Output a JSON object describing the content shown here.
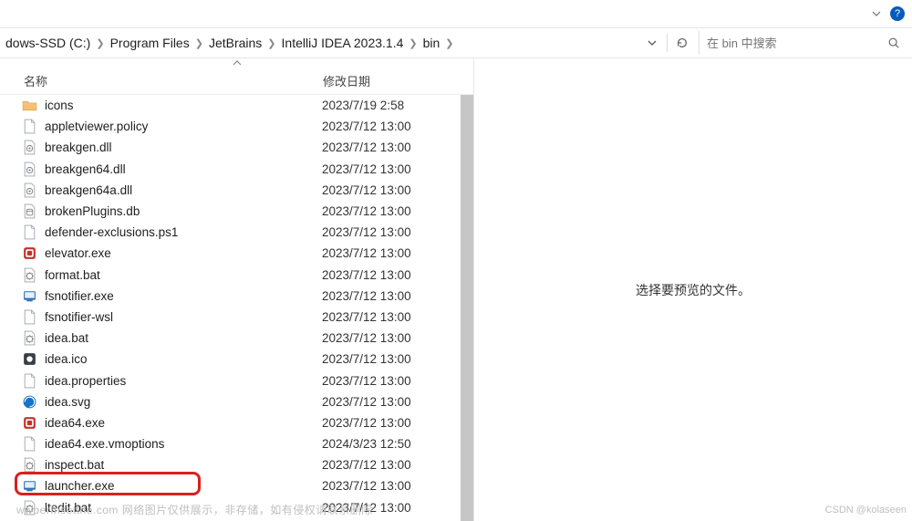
{
  "topbar": {
    "help_tip": "?"
  },
  "breadcrumb": {
    "parts": [
      "dows-SSD (C:)",
      "Program Files",
      "JetBrains",
      "IntelliJ IDEA 2023.1.4",
      "bin"
    ]
  },
  "search": {
    "placeholder": "在 bin 中搜索"
  },
  "columns": {
    "name": "名称",
    "date": "修改日期"
  },
  "preview": {
    "empty": "选择要预览的文件。"
  },
  "watermark": {
    "left": "wwberInsetthe.com  网络图片仅供展示，非存储，如有侵权请联系删除",
    "right": "CSDN @kolaseen"
  },
  "files": [
    {
      "icon": "folder",
      "name": "icons",
      "date": "2023/7/19 2:58"
    },
    {
      "icon": "file",
      "name": "appletviewer.policy",
      "date": "2023/7/12 13:00"
    },
    {
      "icon": "dll",
      "name": "breakgen.dll",
      "date": "2023/7/12 13:00"
    },
    {
      "icon": "dll",
      "name": "breakgen64.dll",
      "date": "2023/7/12 13:00"
    },
    {
      "icon": "dll",
      "name": "breakgen64a.dll",
      "date": "2023/7/12 13:00"
    },
    {
      "icon": "db",
      "name": "brokenPlugins.db",
      "date": "2023/7/12 13:00"
    },
    {
      "icon": "file",
      "name": "defender-exclusions.ps1",
      "date": "2023/7/12 13:00"
    },
    {
      "icon": "exe2",
      "name": "elevator.exe",
      "date": "2023/7/12 13:00"
    },
    {
      "icon": "bat",
      "name": "format.bat",
      "date": "2023/7/12 13:00"
    },
    {
      "icon": "run",
      "name": "fsnotifier.exe",
      "date": "2023/7/12 13:00"
    },
    {
      "icon": "file",
      "name": "fsnotifier-wsl",
      "date": "2023/7/12 13:00"
    },
    {
      "icon": "bat",
      "name": "idea.bat",
      "date": "2023/7/12 13:00"
    },
    {
      "icon": "ico",
      "name": "idea.ico",
      "date": "2023/7/12 13:00"
    },
    {
      "icon": "file",
      "name": "idea.properties",
      "date": "2023/7/12 13:00"
    },
    {
      "icon": "svg",
      "name": "idea.svg",
      "date": "2023/7/12 13:00"
    },
    {
      "icon": "exe2",
      "name": "idea64.exe",
      "date": "2023/7/12 13:00"
    },
    {
      "icon": "file",
      "name": "idea64.exe.vmoptions",
      "date": "2024/3/23 12:50"
    },
    {
      "icon": "bat",
      "name": "inspect.bat",
      "date": "2023/7/12 13:00"
    },
    {
      "icon": "run",
      "name": "launcher.exe",
      "date": "2023/7/12 13:00"
    },
    {
      "icon": "bat",
      "name": "ltedit.bat",
      "date": "2023/7/12 13:00"
    }
  ]
}
